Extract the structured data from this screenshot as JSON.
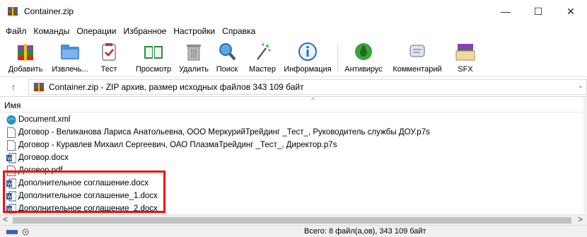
{
  "window": {
    "title": "Container.zip",
    "controls": {
      "minimize": "—",
      "maximize": "☐",
      "close": "✕"
    }
  },
  "menu": [
    "Файл",
    "Команды",
    "Операции",
    "Избранное",
    "Настройки",
    "Справка"
  ],
  "toolbar": {
    "buttons": [
      {
        "label": "Добавить",
        "icon": "add-archive-icon"
      },
      {
        "label": "Извлечь...",
        "icon": "extract-icon"
      },
      {
        "label": "Тест",
        "icon": "test-icon"
      },
      {
        "label": "Просмотр",
        "icon": "view-book-icon"
      },
      {
        "label": "Удалить",
        "icon": "trash-icon"
      },
      {
        "label": "Поиск",
        "icon": "search-icon"
      },
      {
        "label": "Мастер",
        "icon": "wizard-icon"
      },
      {
        "label": "Информация",
        "icon": "info-icon"
      },
      {
        "label": "Антивирус",
        "icon": "antivirus-icon"
      },
      {
        "label": "Комментарий",
        "icon": "comment-icon"
      },
      {
        "label": "SFX",
        "icon": "sfx-icon"
      }
    ]
  },
  "address": {
    "up": "↑",
    "text": "Container.zip - ZIP архив, размер исходных файлов 343 109 байт",
    "chevron": "⌄"
  },
  "columns": {
    "name": "Имя",
    "sort_indicator": "^"
  },
  "files": [
    {
      "name": "Document.xml",
      "type": "edge"
    },
    {
      "name": "Договор - Великанова Лариса Анатольевна, ООО  МеркурийТрейдинг _Тест_, Руководитель службы ДОУ.p7s",
      "type": "blank"
    },
    {
      "name": "Договор - Куравлев Михаил Сергеевич, ОАО  ПлазмаТрейдинг _Тест_, Директор.p7s",
      "type": "blank"
    },
    {
      "name": "Договор.docx",
      "type": "word"
    },
    {
      "name": "Договор.pdf",
      "type": "pdf"
    },
    {
      "name": "Дополнительное соглашение.docx",
      "type": "word"
    },
    {
      "name": "Дополнительное соглашение_1.docx",
      "type": "word"
    },
    {
      "name": "Дополнительное соглашение_2.docx",
      "type": "word"
    }
  ],
  "scroll": {
    "left": "<",
    "right": ">"
  },
  "status": {
    "text": "Всего: 8 файл(а,ов), 343 109 байт"
  },
  "colors": {
    "highlight": "#ee1111",
    "word": "#2b579a",
    "pdf": "#d9372b",
    "edge": "#1f8ed8"
  }
}
